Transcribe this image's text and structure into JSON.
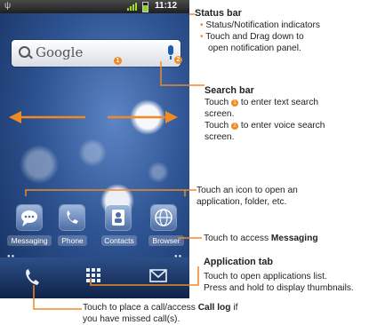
{
  "colors": {
    "accent": "#f08a24",
    "signal": "#9fdc2a",
    "wallpaper": "#2f5594"
  },
  "statusbar": {
    "time": "11:12"
  },
  "searchbar": {
    "label": "Google",
    "text_marker": "1",
    "voice_marker": "2"
  },
  "dock": {
    "items": [
      {
        "label": "Messaging",
        "icon": "speech-bubble-icon"
      },
      {
        "label": "Phone",
        "icon": "phone-icon"
      },
      {
        "label": "Contacts",
        "icon": "contact-card-icon"
      },
      {
        "label": "Browser",
        "icon": "globe-icon"
      }
    ]
  },
  "bottom_bar": {
    "icons": [
      "phone-handset-icon",
      "app-grid-icon",
      "envelope-icon"
    ]
  },
  "annotations": {
    "status_bar": {
      "title": "Status bar",
      "bullet1": "Status/Notification indicators",
      "bullet2_line1": "Touch and Drag down to",
      "bullet2_line2": "open notification panel."
    },
    "search_bar": {
      "title": "Search bar",
      "line1_pre": "Touch",
      "line1_marker": "1",
      "line1_post": "to enter text search",
      "line2": "screen.",
      "line3_pre": "Touch",
      "line3_marker": "2",
      "line3_post": "to enter voice search",
      "line4": "screen."
    },
    "icons": {
      "line1": "Touch an icon to open an",
      "line2": "application, folder, etc."
    },
    "messaging": {
      "pre": "Touch to access",
      "bold": "Messaging"
    },
    "app_tab": {
      "title": "Application tab",
      "line1": "Touch to open applications list.",
      "line2": "Press and hold to display thumbnails."
    },
    "call": {
      "pre": "Touch to place a call/access",
      "bold": "Call log",
      "post": "if",
      "line2": "you have missed call(s)."
    }
  }
}
